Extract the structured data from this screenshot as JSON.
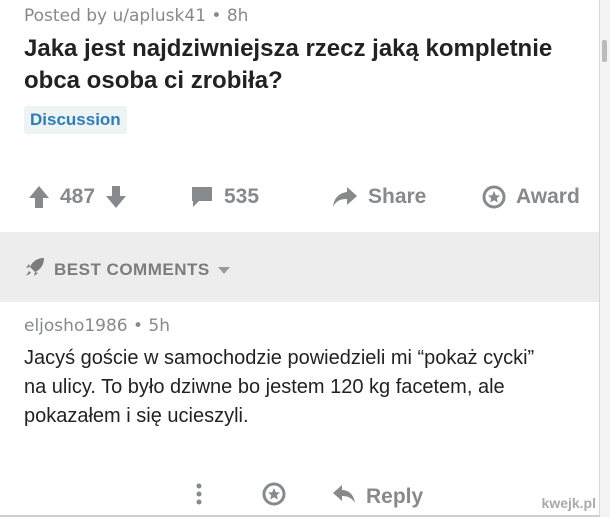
{
  "post": {
    "meta": "Posted by u/aplusk41 • 8h",
    "title": "Jaka jest najdziwniejsza rzecz jaką kompletnie obca osoba ci zrobiła?",
    "flair": "Discussion",
    "votes": "487",
    "comments": "535",
    "share_label": "Share",
    "award_label": "Award"
  },
  "best_comments": {
    "label": "BEST COMMENTS"
  },
  "comment": {
    "meta": "eljosho1986 • 5h",
    "body": "Jacyś goście w samochodzie powiedzieli mi “pokaż cycki” na ulicy. To było dziwne bo jestem 120 kg facetem, ale pokazałem i się ucieszyli.",
    "reply_label": "Reply"
  },
  "watermark": "kwejk.pl",
  "icons": {
    "upvote": "arrow-up-icon",
    "downvote": "arrow-down-icon",
    "comments": "comment-bubble-icon",
    "share": "share-arrow-icon",
    "award": "award-icon",
    "best": "rocket-icon",
    "more": "more-vertical-icon",
    "reply": "reply-arrow-icon"
  },
  "colors": {
    "flair_text": "#2b7fb8",
    "muted": "#878a8c",
    "section_bg": "#ededed"
  }
}
